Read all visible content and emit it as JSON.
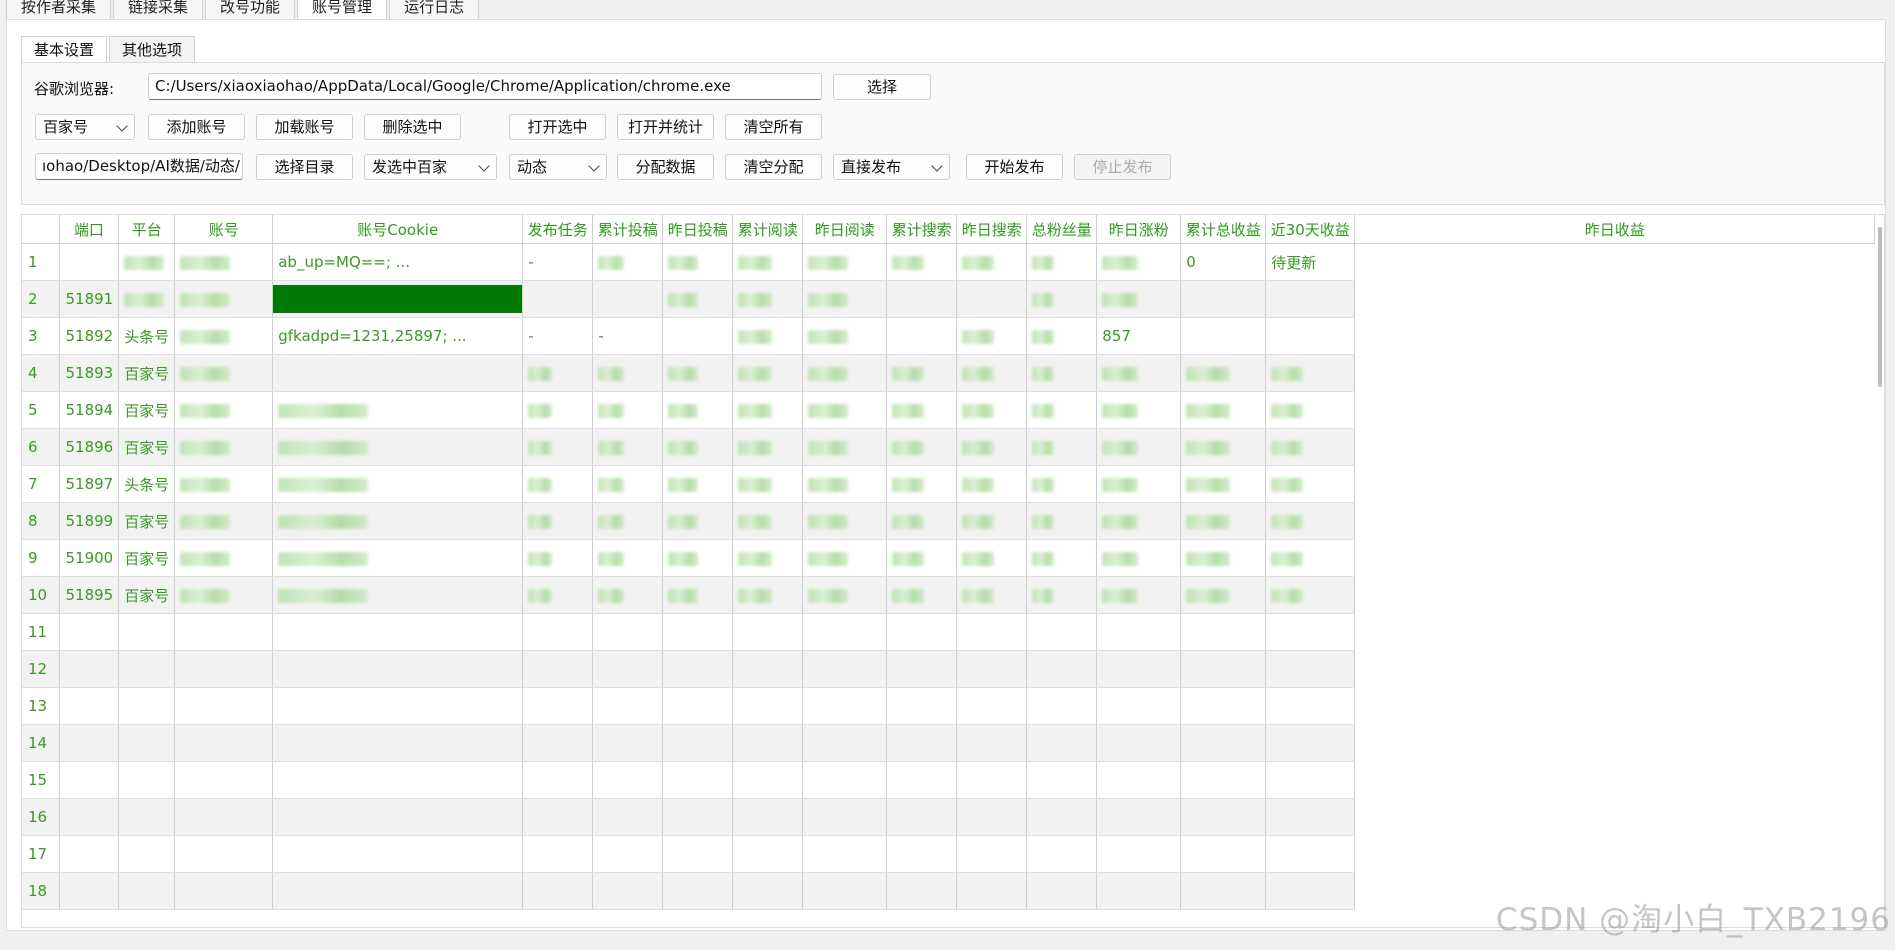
{
  "top_tabs": [
    "按作者采集",
    "链接采集",
    "改号功能",
    "账号管理",
    "运行日志"
  ],
  "sub_tabs": [
    "基本设置",
    "其他选项"
  ],
  "settings": {
    "browser_label": "谷歌浏览器:",
    "browser_path": "C:/Users/xiaoxiaohao/AppData/Local/Google/Chrome/Application/chrome.exe",
    "choose_button": "选择",
    "platform_select": "百家号",
    "add_account": "添加账号",
    "load_account": "加载账号",
    "delete_selected": "删除选中",
    "open_selected": "打开选中",
    "open_and_stats": "打开并统计",
    "clear_all": "清空所有",
    "dir_path": "ıohao/Desktop/AI数据/动态/",
    "choose_dir": "选择目录",
    "publish_target_select": "发选中百家",
    "content_type_select": "动态",
    "assign_data": "分配数据",
    "clear_assign": "清空分配",
    "publish_mode_select": "直接发布",
    "start_publish": "开始发布",
    "stop_publish": "停止发布"
  },
  "table": {
    "columns": [
      "端口",
      "平台",
      "账号",
      "账号Cookie",
      "发布任务",
      "累计投稿",
      "昨日投稿",
      "累计阅读",
      "昨日阅读",
      "累计搜索",
      "昨日搜索",
      "总粉丝量",
      "昨日涨粉",
      "累计总收益",
      "近30天收益",
      "昨日收益"
    ],
    "rows": [
      {
        "no": "1",
        "port": "",
        "platform": "",
        "cookie": "ab_up=MQ==; ...",
        "task": "-",
        "thirty": "0",
        "yesterday": "待更新"
      },
      {
        "no": "2",
        "port": "51891",
        "platform": "",
        "cookie": "",
        "task": "",
        "thirty": "",
        "yesterday": ""
      },
      {
        "no": "3",
        "port": "51892",
        "platform": "头条号",
        "cookie": "gfkadpd=1231,25897; ...",
        "task": "-",
        "total_sub": "-",
        "total_income": "857",
        "thirty": "",
        "yesterday": ""
      },
      {
        "no": "4",
        "port": "51893",
        "platform": "百家号",
        "cookie": "",
        "task": "",
        "thirty": "",
        "yesterday": ""
      },
      {
        "no": "5",
        "port": "51894",
        "platform": "百家号",
        "cookie": "",
        "task": "",
        "thirty": "",
        "yesterday": ""
      },
      {
        "no": "6",
        "port": "51896",
        "platform": "百家号",
        "cookie": "",
        "task": "",
        "thirty": "",
        "yesterday": ""
      },
      {
        "no": "7",
        "port": "51897",
        "platform": "头条号",
        "cookie": "",
        "task": "",
        "thirty": "",
        "yesterday": ""
      },
      {
        "no": "8",
        "port": "51899",
        "platform": "百家号",
        "cookie": "",
        "task": "",
        "thirty": "",
        "yesterday": ""
      },
      {
        "no": "9",
        "port": "51900",
        "platform": "百家号",
        "cookie": "",
        "task": "",
        "thirty": "",
        "yesterday": ""
      },
      {
        "no": "10",
        "port": "51895",
        "platform": "百家号",
        "cookie": "",
        "task": "",
        "thirty": "",
        "yesterday": ""
      },
      {
        "no": "11"
      },
      {
        "no": "12"
      },
      {
        "no": "13"
      },
      {
        "no": "14"
      },
      {
        "no": "15"
      },
      {
        "no": "16"
      },
      {
        "no": "17"
      },
      {
        "no": "18"
      }
    ]
  },
  "watermark": "CSDN @淘小白_TXB2196"
}
